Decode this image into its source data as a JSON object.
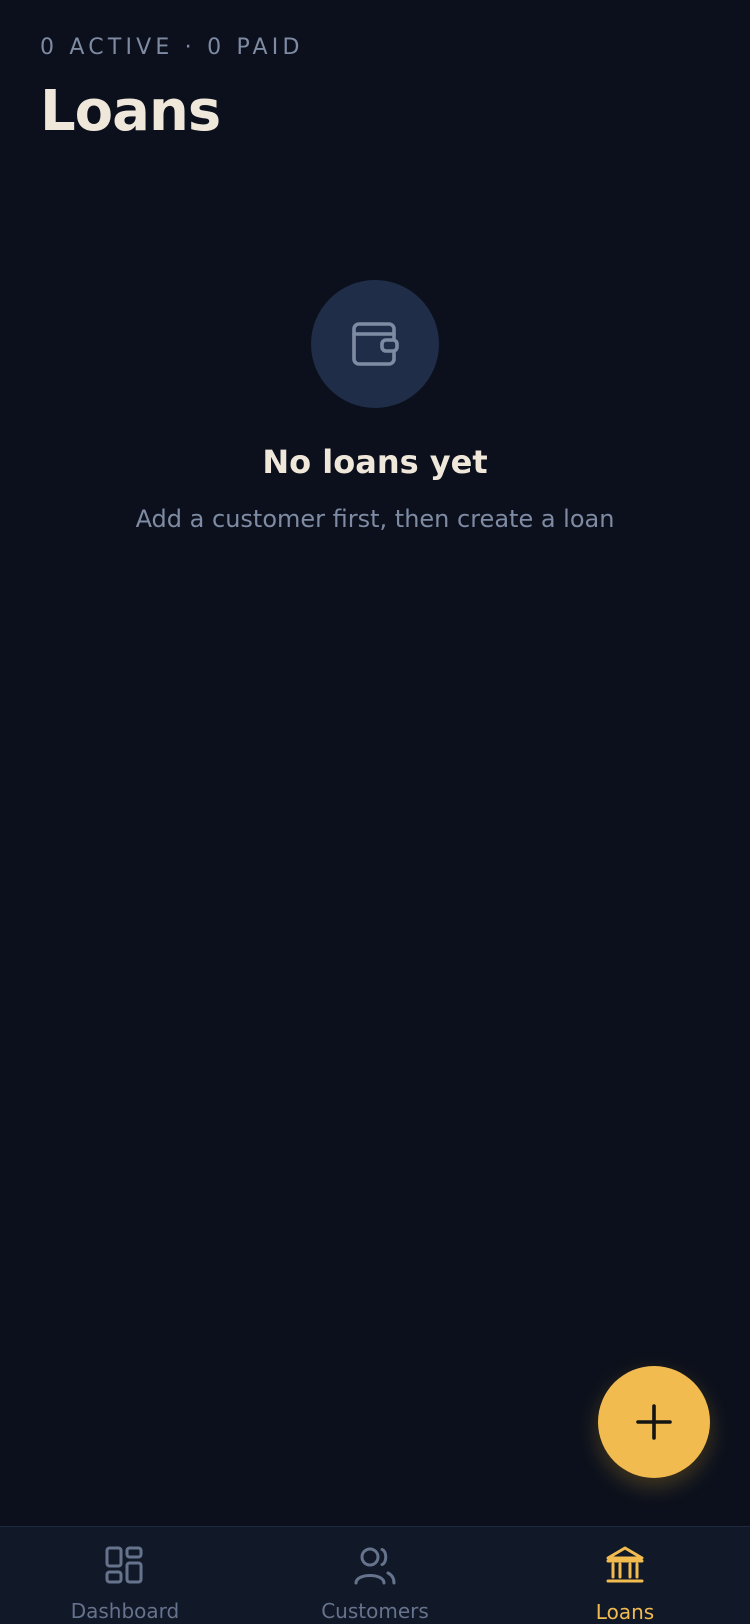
{
  "header": {
    "summary": "0 ACTIVE · 0 PAID",
    "title": "Loans"
  },
  "empty_state": {
    "icon": "wallet-icon",
    "title": "No loans yet",
    "subtitle": "Add a customer first, then create a loan"
  },
  "fab": {
    "icon": "plus-icon"
  },
  "tabbar": {
    "items": [
      {
        "label": "Dashboard",
        "icon": "dashboard-icon",
        "active": false
      },
      {
        "label": "Customers",
        "icon": "users-icon",
        "active": false
      },
      {
        "label": "Loans",
        "icon": "bank-icon",
        "active": true
      }
    ]
  },
  "colors": {
    "background": "#0b101c",
    "accent": "#f2bb50",
    "muted_text": "#7e8ba3",
    "primary_text": "#efe7da",
    "icon_circle": "#1f2d48",
    "tabbar": "#111828"
  }
}
